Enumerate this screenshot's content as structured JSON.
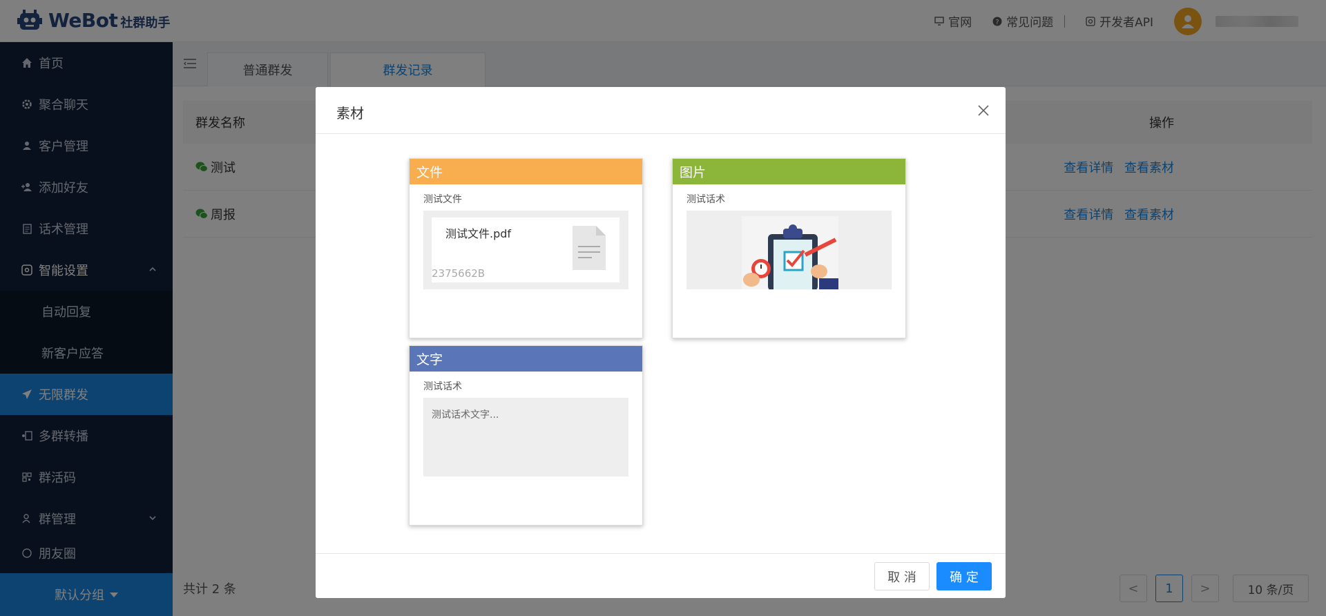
{
  "brand": {
    "name": "WeBot",
    "subtitle": "社群助手"
  },
  "header": {
    "links": [
      {
        "label": "官网",
        "icon": "monitor-icon"
      },
      {
        "label": "常见问题",
        "icon": "help-circle-icon"
      },
      {
        "label": "开发者API",
        "icon": "api-icon"
      }
    ]
  },
  "sidebar": {
    "items": [
      {
        "label": "首页",
        "icon": "home-icon"
      },
      {
        "label": "聚合聊天",
        "icon": "gear-icon"
      },
      {
        "label": "客户管理",
        "icon": "user-icon"
      },
      {
        "label": "添加好友",
        "icon": "user-add-icon"
      },
      {
        "label": "话术管理",
        "icon": "document-icon"
      },
      {
        "label": "智能设置",
        "icon": "settings-icon"
      },
      {
        "label": "自动回复"
      },
      {
        "label": "新客户应答"
      },
      {
        "label": "无限群发",
        "icon": "send-icon"
      },
      {
        "label": "多群转播",
        "icon": "broadcast-icon"
      },
      {
        "label": "群活码",
        "icon": "qrcode-icon"
      },
      {
        "label": "群管理",
        "icon": "group-icon"
      },
      {
        "label": "朋友圈",
        "icon": "moments-icon"
      }
    ],
    "footer": "默认分组"
  },
  "tabs": [
    "普通群发",
    "群发记录"
  ],
  "table": {
    "columns": {
      "name": "群发名称",
      "ops": "操作"
    },
    "rows": [
      {
        "name": "测试",
        "op1": "查看详情",
        "op2": "查看素材"
      },
      {
        "name": "周报",
        "op1": "查看详情",
        "op2": "查看素材"
      }
    ],
    "total": "共计 2 条"
  },
  "pager": {
    "current": "1",
    "size": "10 条/页",
    "prev": "<",
    "next": ">"
  },
  "modal": {
    "title": "素材",
    "cards": {
      "file": {
        "header": "文件",
        "sub": "测试文件",
        "file_name": "测试文件.pdf",
        "file_size": "2375662B",
        "color": "#f8ad4e"
      },
      "image": {
        "header": "图片",
        "sub": "测试话术",
        "color": "#8bb63a"
      },
      "text": {
        "header": "文字",
        "sub": "测试话术",
        "preview": "测试话术文字...",
        "color": "#5a76b8"
      }
    },
    "cancel": "取 消",
    "ok": "确 定"
  },
  "colors": {
    "accent": "#1a86e0",
    "sidebar": "#10213a"
  }
}
